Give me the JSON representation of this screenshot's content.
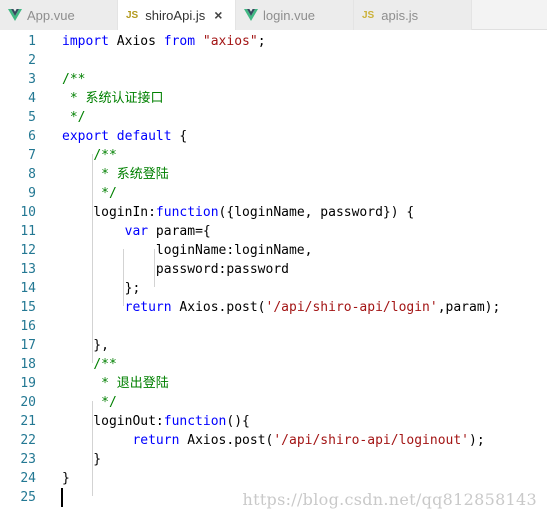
{
  "tabs": [
    {
      "label": "App.vue",
      "icon": "vue-icon",
      "active": false
    },
    {
      "label": "shiroApi.js",
      "icon": "js-icon",
      "active": true,
      "close": "×"
    },
    {
      "label": "login.vue",
      "icon": "vue-icon",
      "active": false
    },
    {
      "label": "apis.js",
      "icon": "js-icon",
      "active": false
    }
  ],
  "js_badge": "JS",
  "colors": {
    "keyword": "#0000ff",
    "string": "#a31515",
    "comment": "#008000",
    "line_number": "#237893",
    "vue_green": "#41b883"
  },
  "code_lines": [
    [
      [
        "kw",
        "import"
      ],
      [
        "p",
        " Axios "
      ],
      [
        "kw",
        "from"
      ],
      [
        "p",
        " "
      ],
      [
        "str",
        "\"axios\""
      ],
      [
        "p",
        ";"
      ]
    ],
    [],
    [
      [
        "cm",
        "/**"
      ]
    ],
    [
      [
        "cm",
        " * 系统认证接口"
      ]
    ],
    [
      [
        "cm",
        " */"
      ]
    ],
    [
      [
        "kw",
        "export"
      ],
      [
        "p",
        " "
      ],
      [
        "kw",
        "default"
      ],
      [
        "p",
        " {"
      ]
    ],
    [
      [
        "p",
        "    "
      ],
      [
        "cm",
        "/**"
      ]
    ],
    [
      [
        "p",
        "    "
      ],
      [
        "cm",
        " * 系统登陆"
      ]
    ],
    [
      [
        "p",
        "    "
      ],
      [
        "cm",
        " */"
      ]
    ],
    [
      [
        "p",
        "    loginIn:"
      ],
      [
        "kw",
        "function"
      ],
      [
        "p",
        "({loginName, password}) {"
      ]
    ],
    [
      [
        "p",
        "        "
      ],
      [
        "kw",
        "var"
      ],
      [
        "p",
        " param={"
      ]
    ],
    [
      [
        "p",
        "            loginName:loginName,"
      ]
    ],
    [
      [
        "p",
        "            password:password"
      ]
    ],
    [
      [
        "p",
        "        };"
      ]
    ],
    [
      [
        "p",
        "        "
      ],
      [
        "kw",
        "return"
      ],
      [
        "p",
        " Axios.post("
      ],
      [
        "str",
        "'/api/shiro-api/login'"
      ],
      [
        "p",
        ",param);"
      ]
    ],
    [],
    [
      [
        "p",
        "    },"
      ]
    ],
    [
      [
        "p",
        "    "
      ],
      [
        "cm",
        "/**"
      ]
    ],
    [
      [
        "p",
        "    "
      ],
      [
        "cm",
        " * 退出登陆"
      ]
    ],
    [
      [
        "p",
        "    "
      ],
      [
        "cm",
        " */"
      ]
    ],
    [
      [
        "p",
        "    loginOut:"
      ],
      [
        "kw",
        "function"
      ],
      [
        "p",
        "(){"
      ]
    ],
    [
      [
        "p",
        "         "
      ],
      [
        "kw",
        "return"
      ],
      [
        "p",
        " Axios.post("
      ],
      [
        "str",
        "'/api/shiro-api/loginout'"
      ],
      [
        "p",
        ");"
      ]
    ],
    [
      [
        "p",
        "    }"
      ]
    ],
    [
      [
        "p",
        "}"
      ]
    ],
    []
  ],
  "watermark": "https://blog.csdn.net/qq812858143"
}
